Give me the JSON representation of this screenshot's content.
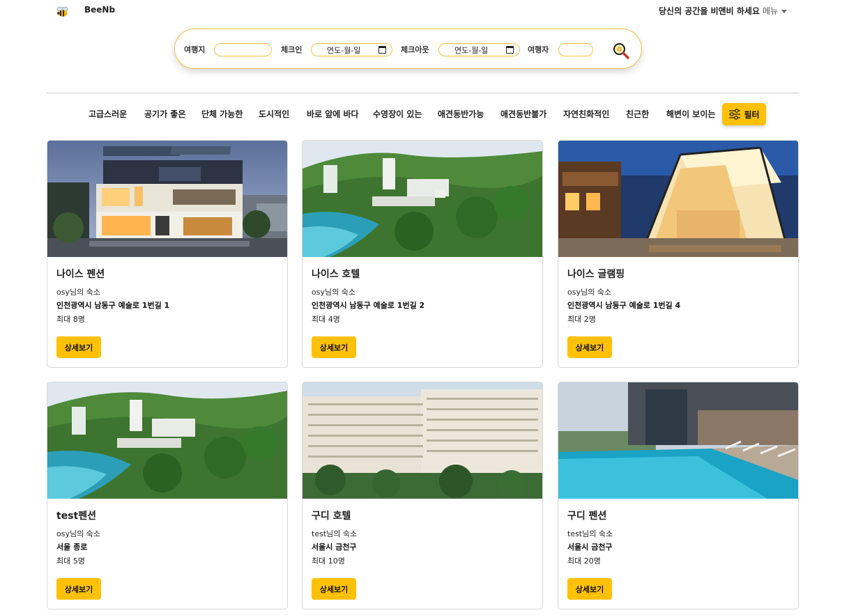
{
  "nav": {
    "brand": "BeeNb",
    "tagline": "당신의 공간을 비앤비 하세요",
    "menu_label": "메뉴"
  },
  "search": {
    "destination_label": "여행지",
    "destination_value": "",
    "checkin_label": "체크인",
    "checkin_value": "연도-월-일",
    "checkout_label": "체크아웃",
    "checkout_value": "연도-월-일",
    "guests_label": "여행자",
    "guests_value": ""
  },
  "categories": [
    "고급스러운",
    "공기가 좋은",
    "단체 가능한",
    "도시적인",
    "바로 앞에 바다",
    "수영장이 있는",
    "애견동반가능",
    "애견동반불가",
    "자연친화적인",
    "친근한",
    "해변이 보이는"
  ],
  "filter_label": "필터",
  "listings": [
    {
      "title": "나이스 펜션",
      "host": "osy",
      "host_suffix": "님의 숙소",
      "address": "인천광역시 남동구 예술로 1번길 1",
      "capacity": "최대 8명",
      "button": "상세보기",
      "image": "modern-house-dusk"
    },
    {
      "title": "나이스 호텔",
      "host": "osy",
      "host_suffix": "님의 숙소",
      "address": "인천광역시 남동구 예술로 1번길 2",
      "capacity": "최대 4명",
      "button": "상세보기",
      "image": "coastal-resort-hillside"
    },
    {
      "title": "나이스 글램핑",
      "host": "osy",
      "host_suffix": "님의 숙소",
      "address": "인천광역시 남동구 예술로 1번길 4",
      "capacity": "최대 2명",
      "button": "상세보기",
      "image": "glamping-tent-night"
    },
    {
      "title": "test펜션",
      "host": "osy",
      "host_suffix": "님의 숙소",
      "address": "서울 종로",
      "capacity": "최대 5명",
      "button": "상세보기",
      "image": "coastal-resort-hillside"
    },
    {
      "title": "구디 호텔",
      "host": "test",
      "host_suffix": "님의 숙소",
      "address": "서울시 금천구",
      "capacity": "최대 10명",
      "button": "상세보기",
      "image": "hotel-facade-palms"
    },
    {
      "title": "구디 펜션",
      "host": "test",
      "host_suffix": "님의 숙소",
      "address": "서울시 금천구",
      "capacity": "최대 20명",
      "button": "상세보기",
      "image": "rooftop-pool"
    }
  ],
  "colors": {
    "accent": "#ffc107",
    "border_yellow": "#f5c33b"
  }
}
